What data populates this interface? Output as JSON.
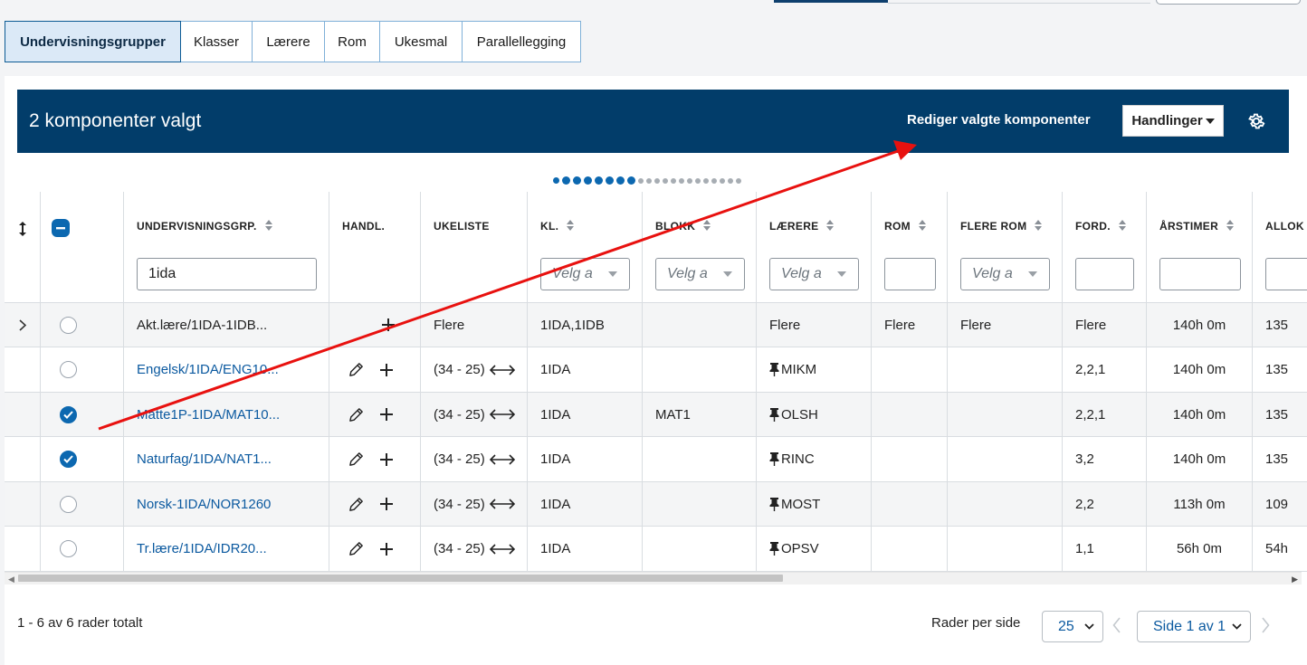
{
  "tabs": [
    {
      "label": "Undervisningsgrupper",
      "active": true
    },
    {
      "label": "Klasser"
    },
    {
      "label": "Lærere"
    },
    {
      "label": "Rom"
    },
    {
      "label": "Ukesmal"
    },
    {
      "label": "Parallellegging"
    }
  ],
  "selection_bar": {
    "count_text": "2 komponenter valgt",
    "edit_link": "Rediger valgte komponenter",
    "actions_button": "Handlinger"
  },
  "pagination_dots": {
    "total": 21,
    "active_from": 1,
    "active_to": 7
  },
  "columns": {
    "group": "UNDERVISNINGSGRP.",
    "actions": "HANDL.",
    "weeklist": "UKELISTE",
    "class": "KL.",
    "block": "BLOKK",
    "teachers": "LÆRERE",
    "room": "ROM",
    "more_rooms": "FLERE ROM",
    "dist": "FORD.",
    "hours": "ÅRSTIMER",
    "alloc": "ALLOK"
  },
  "filters": {
    "group_value": "1ida",
    "select_placeholder": "Velg a"
  },
  "rows": [
    {
      "group": "Akt.lære/1IDA-1IDB...",
      "link": false,
      "edit": false,
      "weeks": "Flere",
      "class": "1IDA,1IDB",
      "block": "",
      "teacher": "Flere",
      "pinned": false,
      "room": "Flere",
      "more_rooms": "Flere",
      "dist": "Flere",
      "hours": "140h 0m",
      "alloc": "135",
      "checked": false,
      "expandable": true
    },
    {
      "group": "Engelsk/1IDA/ENG10...",
      "link": true,
      "edit": true,
      "weeks": "(34 - 25)",
      "class": "1IDA",
      "block": "",
      "teacher": "MIKM",
      "pinned": true,
      "room": "",
      "more_rooms": "",
      "dist": "2,2,1",
      "hours": "140h 0m",
      "alloc": "135",
      "checked": false
    },
    {
      "group": "Matte1P-1IDA/MAT10...",
      "link": true,
      "edit": true,
      "weeks": "(34 - 25)",
      "class": "1IDA",
      "block": "MAT1",
      "teacher": "OLSH",
      "pinned": true,
      "room": "",
      "more_rooms": "",
      "dist": "2,2,1",
      "hours": "140h 0m",
      "alloc": "135",
      "checked": true
    },
    {
      "group": "Naturfag/1IDA/NAT1...",
      "link": true,
      "edit": true,
      "weeks": "(34 - 25)",
      "class": "1IDA",
      "block": "",
      "teacher": "RINC",
      "pinned": true,
      "room": "",
      "more_rooms": "",
      "dist": "3,2",
      "hours": "140h 0m",
      "alloc": "135",
      "checked": true
    },
    {
      "group": "Norsk-1IDA/NOR1260",
      "link": true,
      "edit": true,
      "weeks": "(34 - 25)",
      "class": "1IDA",
      "block": "",
      "teacher": "MOST",
      "pinned": true,
      "room": "",
      "more_rooms": "",
      "dist": "2,2",
      "hours": "113h 0m",
      "alloc": "109",
      "checked": false
    },
    {
      "group": "Tr.lære/1IDA/IDR20...",
      "link": true,
      "edit": true,
      "weeks": "(34 - 25)",
      "class": "1IDA",
      "block": "",
      "teacher": "OPSV",
      "pinned": true,
      "room": "",
      "more_rooms": "",
      "dist": "1,1",
      "hours": "56h 0m",
      "alloc": "54h",
      "checked": false
    }
  ],
  "footer": {
    "total_text": "1 - 6 av 6 rader totalt",
    "rows_per_page_label": "Rader per side",
    "rows_per_page_value": "25",
    "page_value": "Side 1 av 1"
  },
  "colors": {
    "header_bar": "#023d6a",
    "accent": "#0c68b0",
    "link": "#0c5aa0",
    "annotation_arrow": "#e8110f"
  },
  "icons": {
    "resize": "arrow-up-down-icon",
    "expand": "chevron-right-icon",
    "edit": "pencil-icon",
    "add": "plus-icon",
    "weeks": "double-arrow-icon",
    "pin": "pin-icon",
    "settings": "gear-icon"
  }
}
